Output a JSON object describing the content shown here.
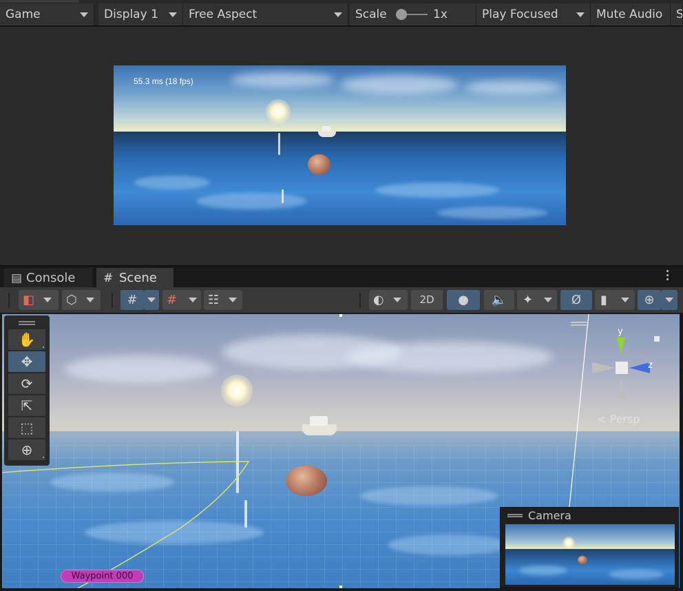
{
  "game_toolbar": {
    "tab": "Game",
    "display": "Display 1",
    "aspect": "Free Aspect",
    "scale_label": "Scale",
    "scale_value": "1x",
    "play_mode": "Play Focused",
    "mute": "Mute Audio",
    "cut_item": "S"
  },
  "game_view": {
    "fps": "55.3 ms (18 fps)"
  },
  "tabs": {
    "console": "Console",
    "scene": "Scene"
  },
  "scene_toolbar": {
    "two_d": "2D"
  },
  "scene_view": {
    "gizmo": {
      "y": "y",
      "z": "z"
    },
    "persp": "Persp",
    "waypoint": "Waypoint 000"
  },
  "camera_preview": {
    "title": "Camera"
  }
}
